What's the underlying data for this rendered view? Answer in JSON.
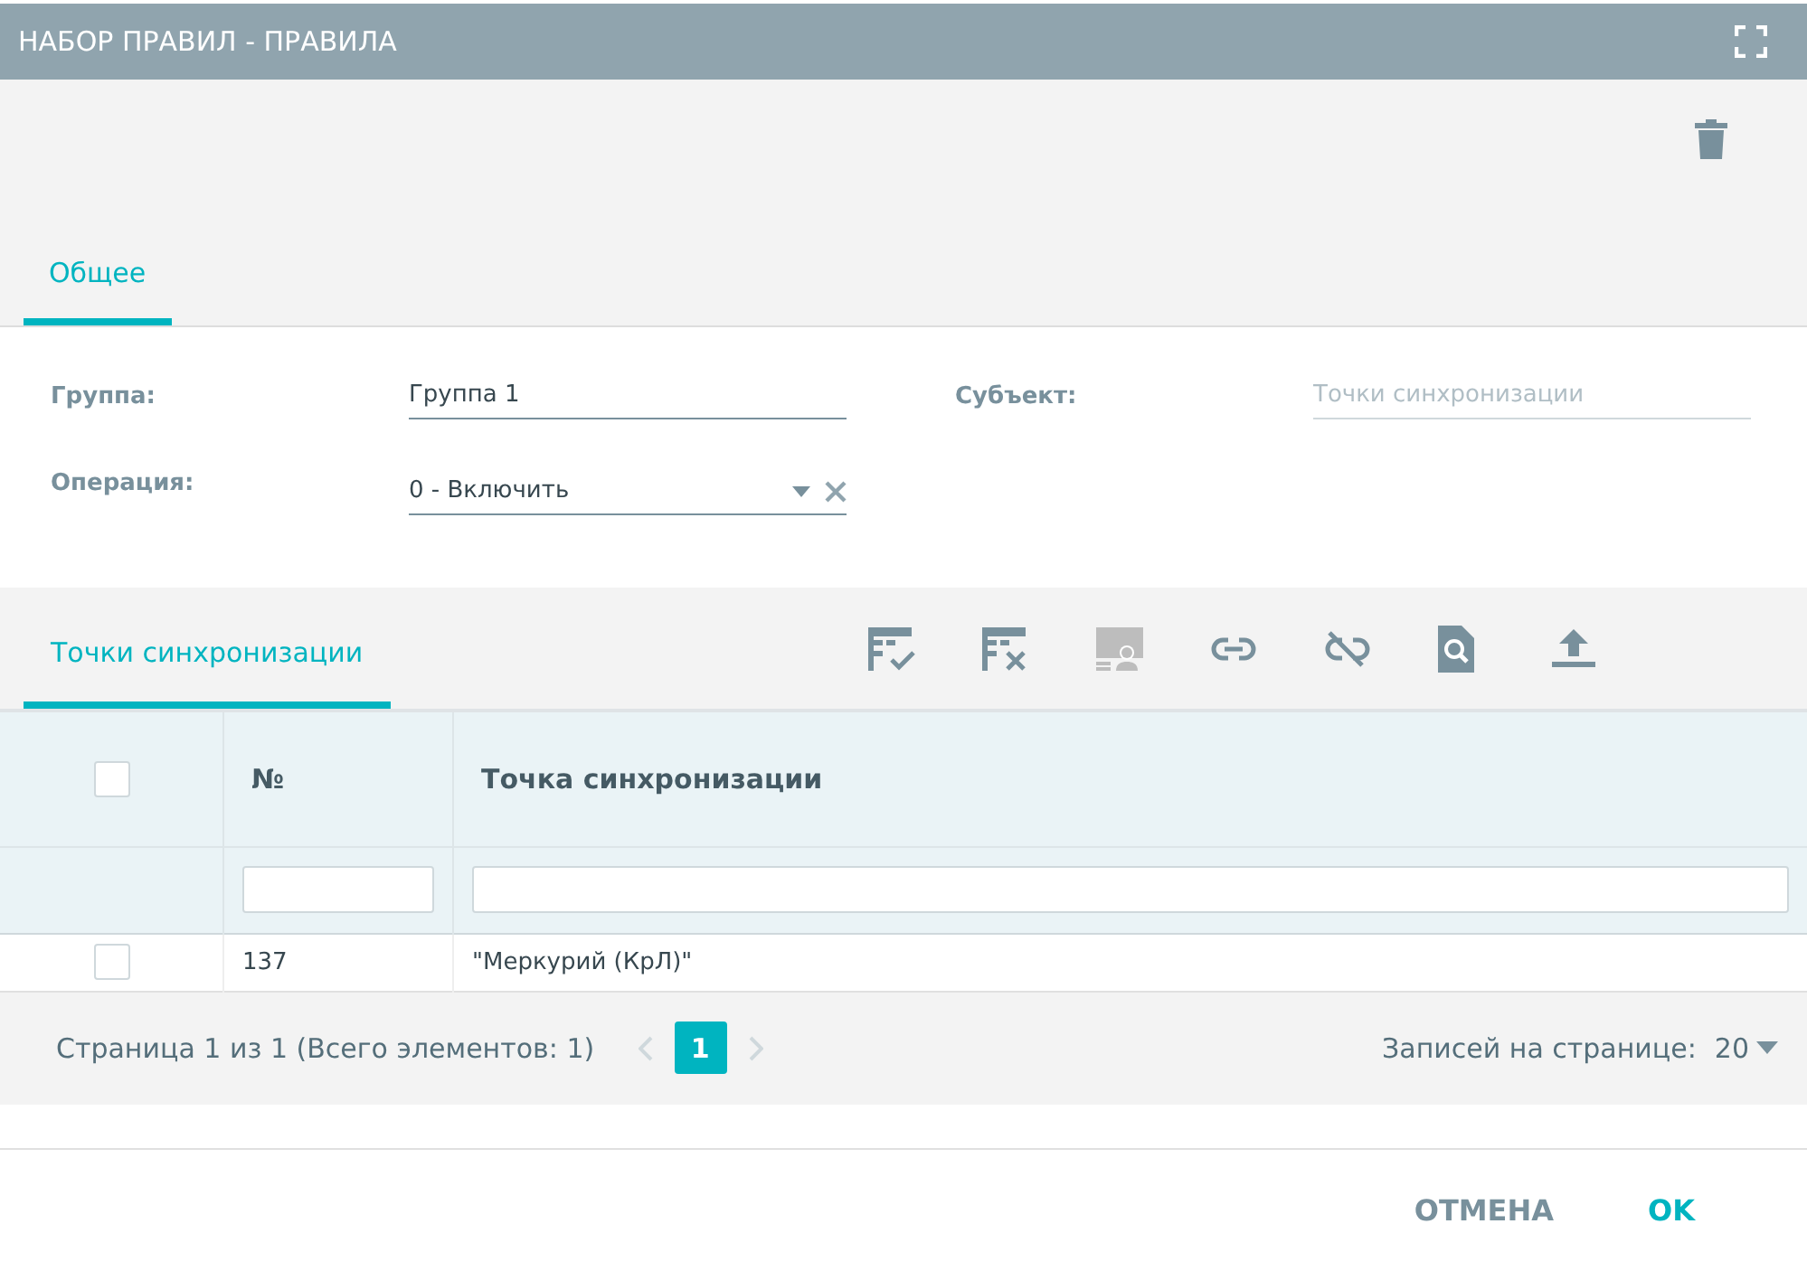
{
  "window": {
    "title": "НАБОР ПРАВИЛ - ПРАВИЛА"
  },
  "tabs": [
    {
      "label": "Общее",
      "selected": true
    }
  ],
  "form": {
    "group": {
      "label": "Группа:",
      "value": "Группа 1"
    },
    "subject": {
      "label": "Субъект:",
      "placeholder": "Точки синхронизации"
    },
    "operation": {
      "label": "Операция:",
      "value": "0 - Включить"
    }
  },
  "section_tabs": [
    {
      "label": "Точки синхронизации",
      "selected": true
    }
  ],
  "toolbar": [
    {
      "kind": "table-check",
      "disabled": false
    },
    {
      "kind": "table-x",
      "disabled": false
    },
    {
      "kind": "screen-person",
      "disabled": true
    },
    {
      "kind": "link",
      "disabled": false
    },
    {
      "kind": "unlink",
      "disabled": false
    },
    {
      "kind": "doc-search",
      "disabled": false
    },
    {
      "kind": "upload",
      "disabled": false
    }
  ],
  "table": {
    "select_all": {
      "checked": false
    },
    "columns": [
      "№",
      "Точка синхронизации"
    ],
    "rows": [
      {
        "checked": false,
        "cells": [
          "137",
          "\"Меркурий (КрЛ)\""
        ]
      }
    ]
  },
  "pager": {
    "summary": "Страница 1 из 1 (Всего элементов: 1)",
    "pages": [
      {
        "label": "1",
        "selected": true
      }
    ],
    "page_size_label": "Записей на странице:",
    "page_size": "20"
  },
  "buttons": [
    {
      "label": "ОТМЕНА",
      "kind": "secondary"
    },
    {
      "label": "OK",
      "kind": "primary"
    }
  ]
}
